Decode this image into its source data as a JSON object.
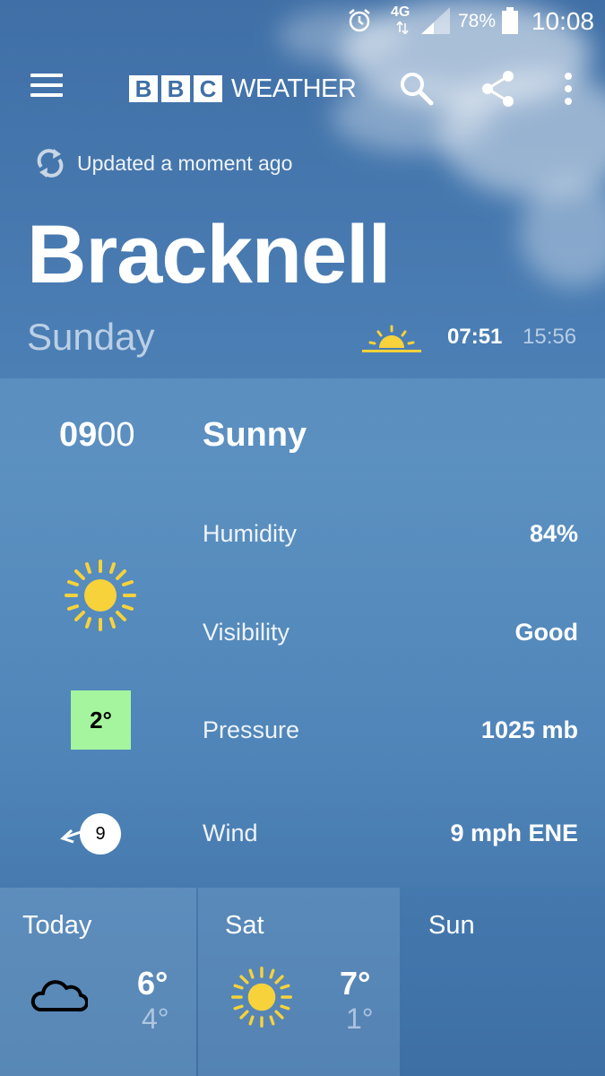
{
  "status_bar": {
    "network": "4G",
    "battery": "78%",
    "time": "10:08"
  },
  "app_bar": {
    "logo_letters": [
      "B",
      "B",
      "C"
    ],
    "logo_text": "WEATHER",
    "icons": [
      "menu-icon",
      "search-icon",
      "share-icon",
      "more-vertical-icon"
    ]
  },
  "update_status": "Updated a moment ago",
  "location": "Bracknell",
  "day": {
    "name": "Sunday",
    "sunrise": "07:51",
    "sunset": "15:56"
  },
  "detail": {
    "hour_bold": "09",
    "hour_rest": "00",
    "condition": "Sunny",
    "condition_icon": "sun-icon",
    "temperature": "2°",
    "temperature_color": "#a5f59f",
    "wind_speed_badge": "9",
    "rows": [
      {
        "label": "Humidity",
        "value": "84%"
      },
      {
        "label": "Visibility",
        "value": "Good"
      },
      {
        "label": "Pressure",
        "value": "1025 mb"
      },
      {
        "label": "Wind",
        "value": "9 mph ENE"
      }
    ]
  },
  "forecast": [
    {
      "name": "Today",
      "icon": "cloud-icon",
      "high": "6°",
      "low": "4°"
    },
    {
      "name": "Sat",
      "icon": "sun-icon",
      "high": "7°",
      "low": "1°"
    },
    {
      "name": "Sun"
    }
  ],
  "colors": {
    "sun_yellow": "#f7d23a",
    "temp_box": "#a5f59f"
  }
}
